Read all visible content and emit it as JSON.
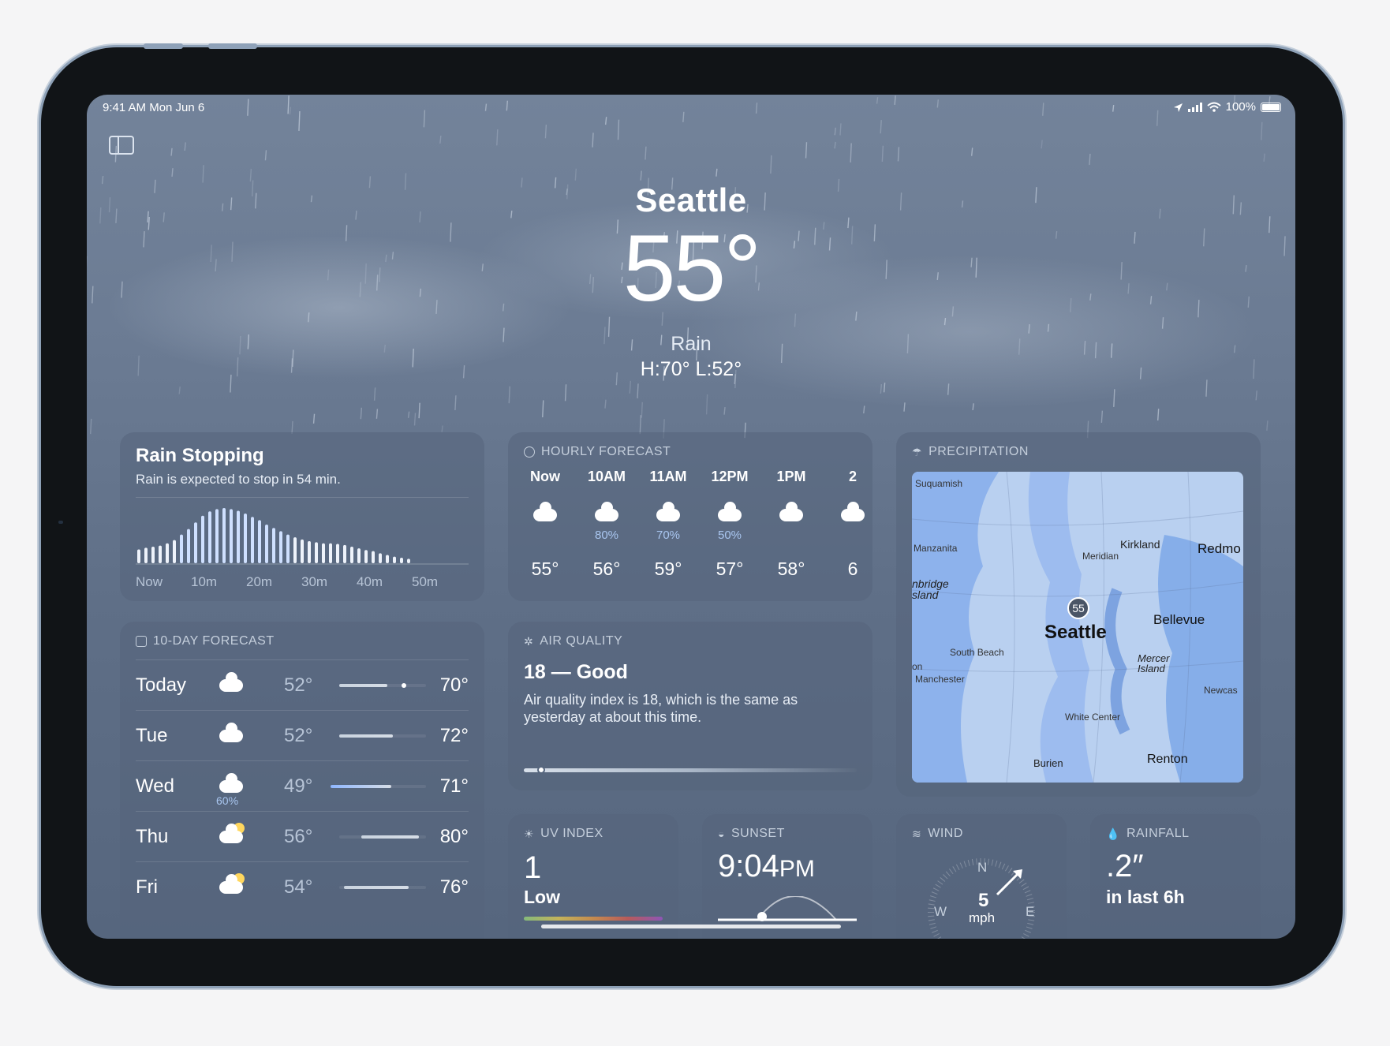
{
  "status_bar": {
    "time_date": "9:41 AM   Mon Jun 6",
    "battery": "100%"
  },
  "hero": {
    "city": "Seattle",
    "temperature": "55°",
    "condition": "Rain",
    "hi_lo": "H:70°  L:52°"
  },
  "rain_card": {
    "title": "Rain Stopping",
    "subtitle": "Rain is expected to stop in 54 min.",
    "axis_labels": [
      "Now",
      "10m",
      "20m",
      "30m",
      "40m",
      "50m"
    ],
    "intensity": [
      0.25,
      0.28,
      0.3,
      0.32,
      0.36,
      0.42,
      0.52,
      0.62,
      0.74,
      0.86,
      0.94,
      0.98,
      1,
      0.98,
      0.95,
      0.9,
      0.84,
      0.78,
      0.7,
      0.64,
      0.58,
      0.52,
      0.47,
      0.43,
      0.4,
      0.38,
      0.36,
      0.36,
      0.35,
      0.33,
      0.3,
      0.27,
      0.24,
      0.22,
      0.18,
      0.15,
      0.12,
      0.1,
      0.08
    ]
  },
  "hourly": {
    "heading": "HOURLY FORECAST",
    "items": [
      {
        "time": "Now",
        "precip": "",
        "temp": "55°"
      },
      {
        "time": "10AM",
        "precip": "80%",
        "temp": "56°"
      },
      {
        "time": "11AM",
        "precip": "70%",
        "temp": "59°"
      },
      {
        "time": "12PM",
        "precip": "50%",
        "temp": "57°"
      },
      {
        "time": "1PM",
        "precip": "",
        "temp": "58°"
      },
      {
        "time": "2",
        "precip": "",
        "temp": "6"
      }
    ]
  },
  "precipitation": {
    "heading": "PRECIPITATION",
    "map_labels": {
      "suquamish": "Suquamish",
      "kirkland": "Kirkland",
      "redmond": "Redmo",
      "manzanita": "Manzanita",
      "meridian": "Meridian",
      "bainbridge": "nbridge\nsland",
      "seattle": "Seattle",
      "bellevue": "Bellevue",
      "south_beach": "South Beach",
      "mercer": "Mercer\nIsland",
      "manchester": "Manchester",
      "on": "on",
      "newcastle": "Newcas",
      "white_center": "White Center",
      "burien": "Burien",
      "renton": "Renton",
      "location_temp": "55"
    }
  },
  "ten_day": {
    "heading": "10-DAY FORECAST",
    "days": [
      {
        "day": "Today",
        "precip": "",
        "low": "52°",
        "high": "70°",
        "bar_start": 0.0,
        "bar_end": 0.55,
        "current": 0.35,
        "icon": "cloud"
      },
      {
        "day": "Tue",
        "precip": "",
        "low": "52°",
        "high": "72°",
        "bar_start": 0.0,
        "bar_end": 0.62,
        "current": null,
        "icon": "cloud"
      },
      {
        "day": "Wed",
        "precip": "60%",
        "low": "49°",
        "high": "71°",
        "bar_start": -0.1,
        "bar_end": 0.6,
        "current": null,
        "icon": "cloud-rain"
      },
      {
        "day": "Thu",
        "precip": "",
        "low": "56°",
        "high": "80°",
        "bar_start": 0.25,
        "bar_end": 0.92,
        "current": null,
        "icon": "partly-sunny"
      },
      {
        "day": "Fri",
        "precip": "",
        "low": "54°",
        "high": "76°",
        "bar_start": 0.05,
        "bar_end": 0.8,
        "current": null,
        "icon": "partly-sunny"
      }
    ]
  },
  "air_quality": {
    "heading": "AIR QUALITY",
    "value": "18 — Good",
    "description": "Air quality index is 18, which is the same as yesterday at about this time.",
    "level": 0.04
  },
  "uv": {
    "heading": "UV INDEX",
    "value": "1",
    "label": "Low"
  },
  "sunset": {
    "heading": "SUNSET",
    "time": "9:04",
    "suffix": "PM"
  },
  "wind": {
    "heading": "WIND",
    "speed": "5",
    "unit": "mph",
    "n": "N",
    "w": "W",
    "e": "E"
  },
  "rainfall": {
    "heading": "RAINFALL",
    "amount": ".2″",
    "period": "in last 6h"
  },
  "colors": {
    "screen_bg": "#66768e",
    "card_bg": "rgba(85,100,124,0.55)",
    "map_water": "#7fa6e6",
    "map_land": "#b9d0f0",
    "accent_blue": "#8fb7ff"
  }
}
